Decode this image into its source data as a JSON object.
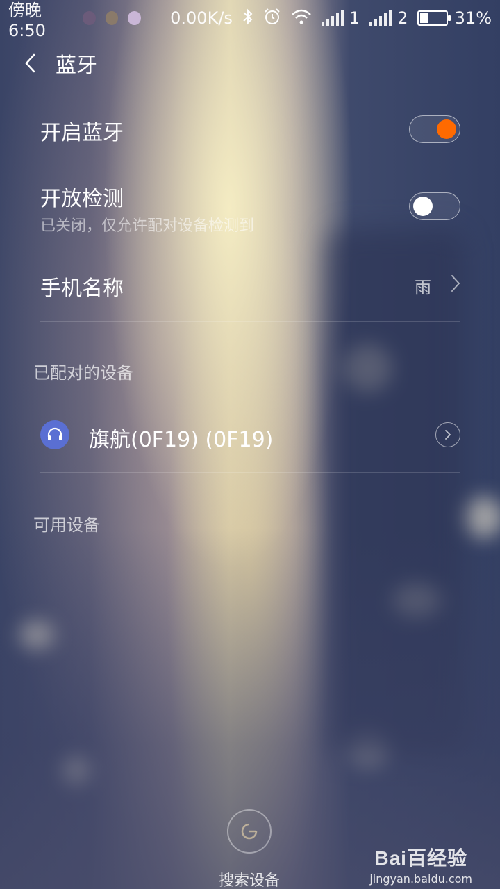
{
  "status_bar": {
    "time": "傍晚6:50",
    "net_speed": "0.00K/s",
    "sim1": "1",
    "sim2": "2",
    "battery_percent_text": "31%",
    "battery_level": 0.31,
    "icons": [
      "notification-icon-1",
      "notification-icon-2",
      "notification-icon-3",
      "bluetooth-icon",
      "alarm-icon",
      "wifi-icon",
      "signal-icon",
      "battery-icon"
    ]
  },
  "header": {
    "title": "蓝牙"
  },
  "settings": {
    "bluetooth": {
      "label": "开启蓝牙",
      "enabled": true
    },
    "discoverable": {
      "label": "开放检测",
      "subtitle": "已关闭，仅允许配对设备检测到",
      "enabled": false
    },
    "phone_name": {
      "label": "手机名称",
      "value": "雨"
    }
  },
  "paired_section": {
    "title": "已配对的设备",
    "devices": [
      {
        "name": "旗航(0F19) (0F19)",
        "icon": "headset-icon"
      }
    ]
  },
  "available_section": {
    "title": "可用设备"
  },
  "search": {
    "label": "搜索设备"
  },
  "watermark": {
    "brand": "Bai百经验",
    "url": "jingyan.baidu.com"
  },
  "colors": {
    "accent": "#ff6a00",
    "device_icon_bg": "#5a6fd3"
  }
}
